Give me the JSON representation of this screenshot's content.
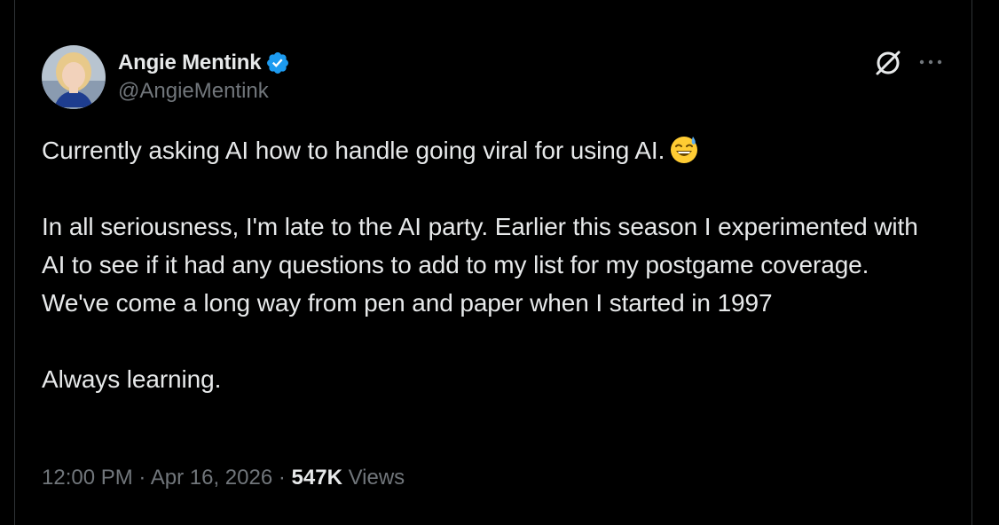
{
  "author": {
    "display_name": "Angie Mentink",
    "handle": "@AngieMentink",
    "verified": true
  },
  "icons": {
    "verified": "verified-badge-icon",
    "grok": "grok-icon",
    "more": "more-options-icon",
    "emoji": "grinning-face-with-sweat-emoji"
  },
  "tweet": {
    "line1": "Currently asking AI how to handle going viral for using AI.",
    "paragraph2": "In all seriousness, I'm late to the AI party. Earlier this season I experimented with AI to see if it had any questions to add to my list for my postgame coverage. We've come a long way from pen and paper when I started in 1997",
    "paragraph3": "Always learning."
  },
  "meta": {
    "time": "12:00 PM",
    "separator": "·",
    "date": "Apr 16, 2026",
    "views_count": "547K",
    "views_label": "Views"
  },
  "colors": {
    "background": "#000000",
    "text_primary": "#e7e9ea",
    "text_secondary": "#71767b",
    "verified_blue": "#1d9bf0",
    "border": "#2f3336"
  }
}
